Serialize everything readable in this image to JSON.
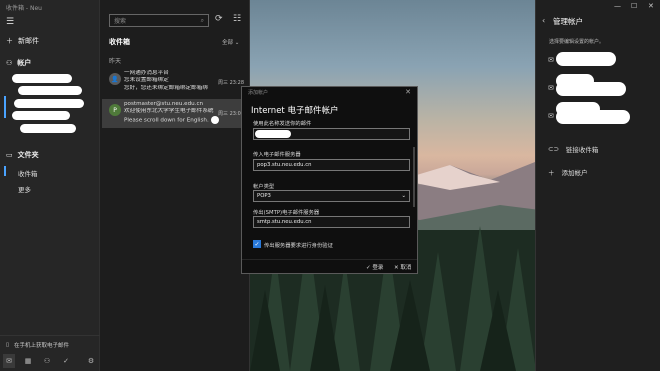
{
  "sidebar": {
    "window_title": "收件箱 - Neu",
    "new_mail": "新邮件",
    "accounts_title": "帐户",
    "folders_title": "文件夹",
    "folders": [
      "收件箱",
      "更多"
    ],
    "phone_promo": "在手机上获取电子邮件"
  },
  "list": {
    "search_placeholder": "搜索",
    "inbox_title": "收件箱",
    "filter": "全部",
    "date_group": "昨天",
    "messages": [
      {
        "avatar": "👤",
        "line1": "一网通办消息平台",
        "line2": "您未设置邮箱绑定",
        "line3": "您好，您还未绑定邮箱绑定邮箱绑",
        "time": "周三 23:28"
      },
      {
        "avatar": "P",
        "line1": "postmaster@stu.neu.edu.cn",
        "line2": "欢迎使用东北大学学生电子邮件系统",
        "line3": "Please scroll down for English.",
        "time": "周三 23:04"
      }
    ]
  },
  "dialog": {
    "window_title": "添加帐户",
    "heading": "Internet 电子邮件帐户",
    "label_name": "使用此名称发送你的邮件",
    "label_incoming": "传入电子邮件服务器",
    "incoming_value": "pop3.stu.neu.edu.cn",
    "label_type": "帐户类型",
    "type_value": "POP3",
    "label_outgoing": "传出(SMTP)电子邮件服务器",
    "outgoing_value": "smtp.stu.neu.edu.cn",
    "checkbox_label": "传出服务器要求进行身份验证",
    "sign_in": "登录",
    "cancel": "取消"
  },
  "manager": {
    "title": "管理帐户",
    "subtitle": "选择要编辑设置的帐户。",
    "link_inboxes": "链接收件箱",
    "add_account": "添加帐户"
  },
  "colors": {
    "accent": "#2979d9",
    "selection": "#4aa3ff"
  }
}
